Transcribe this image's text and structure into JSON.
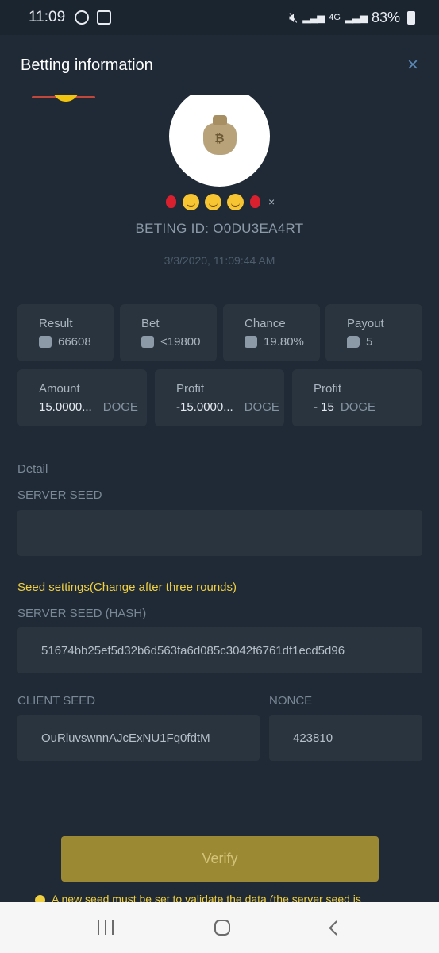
{
  "status_bar": {
    "time": "11:09",
    "network": "4G",
    "battery": "83%"
  },
  "header": {
    "title": "Betting information",
    "close": "×"
  },
  "avatar": {
    "icon": "bitcoin-money-bag-icon",
    "symbol": "₿"
  },
  "bet": {
    "id": "BETING ID: O0DU3EA4RT",
    "datetime": "3/3/2020, 11:09:44 AM",
    "close_mark": "×"
  },
  "stats": [
    {
      "label": "Result",
      "value": "66608",
      "icon": "result-icon"
    },
    {
      "label": "Bet",
      "value": "<19800",
      "icon": "dice-icon"
    },
    {
      "label": "Chance",
      "value": "19.80%",
      "icon": "chance-icon"
    },
    {
      "label": "Payout",
      "value": "5",
      "icon": "payout-icon"
    }
  ],
  "amounts": [
    {
      "label": "Amount",
      "value": "15.0000...",
      "unit": "DOGE"
    },
    {
      "label": "Profit",
      "value": "-15.0000...",
      "unit": "DOGE"
    },
    {
      "label": "Profit",
      "value": "- 15",
      "unit": "DOGE"
    }
  ],
  "detail": {
    "title": "Detail",
    "server_seed_label": "SERVER SEED",
    "server_seed_value": "",
    "seed_note": "Seed settings(Change after three rounds)",
    "server_seed_hash_label": "SERVER SEED (HASH)",
    "server_seed_hash": "51674bb25ef5d32b6d563fa6d085c3042f6761df1ecd5d96",
    "client_seed_label": "CLIENT SEED",
    "client_seed": "OuRluvswnnAJcExNU1Fq0fdtM",
    "nonce_label": "NONCE",
    "nonce": "423810"
  },
  "verify_button": "Verify",
  "notice": "A new seed must be set to validate the data (the server seed is",
  "colors": {
    "background": "#1f2a36",
    "card": "#29343f",
    "accent_yellow": "#f0d040",
    "verify_button": "#9c8933"
  }
}
